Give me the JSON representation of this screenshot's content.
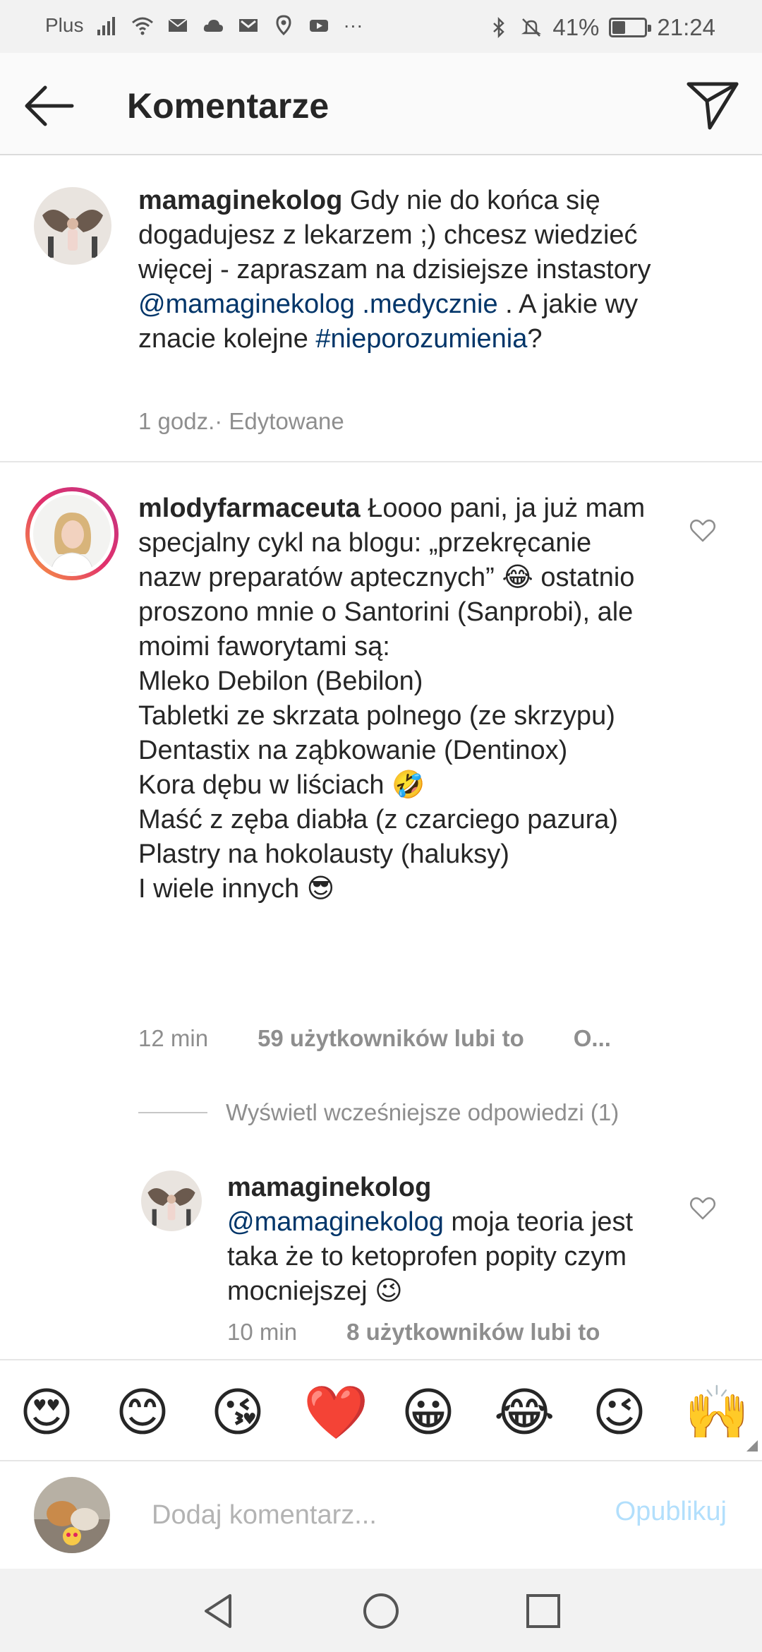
{
  "status_bar": {
    "carrier": "Plus",
    "battery": "41%",
    "battery_level": 0.41,
    "time": "21:24",
    "more": "···"
  },
  "header": {
    "title": "Komentarze"
  },
  "caption": {
    "username": "mamaginekolog",
    "text_1": " Gdy nie do końca się dogadujesz z lekarzem ;) chcesz wiedzieć więcej - zapraszam na dzisiejsze instastory ",
    "mention": "@mamaginekolog .medycznie",
    "text_2": " . A jakie wy znacie kolejne ",
    "hashtag": "#nieporozumienia",
    "text_3": "?",
    "time": "1 godz.",
    "edited": " · Edytowane"
  },
  "comment": {
    "username": "mlodyfarmaceuta",
    "lines": [
      " Łoooo pani, ja już mam specjalny cykl na blogu: „przekręcanie nazw preparatów aptecznych” 😂 ostatnio proszono mnie o Santorini (Sanprobi), ale moimi faworytami są:",
      "Mleko Debilon (Bebilon)",
      "Tabletki ze skrzata polnego (ze skrzypu)",
      "Dentastix na ząbkowanie (Dentinox)",
      "Kora dębu w liściach 🤣",
      "Maść z zęba diabła (z czarciego pazura)",
      "Plastry na hokolausty (haluksy)",
      "I wiele innych 😎"
    ],
    "time": "12 min",
    "likes": "59 użytkowników lubi to",
    "reply": "O..."
  },
  "replies_toggle": "Wyświetl wcześniejsze odpowiedzi (1)",
  "reply": {
    "username": "mamaginekolog",
    "mention": "@mamaginekolog",
    "text": " moja teoria jest taka że to ketoprofen popity czym mocniejszej 😉",
    "time": "10 min",
    "likes": "8 użytkowników lubi to"
  },
  "emojis": [
    "😍",
    "😊",
    "😘",
    "❤️",
    "😀",
    "😂",
    "😉",
    "🙌"
  ],
  "input": {
    "placeholder": "Dodaj komentarz...",
    "publish": "Opublikuj"
  }
}
